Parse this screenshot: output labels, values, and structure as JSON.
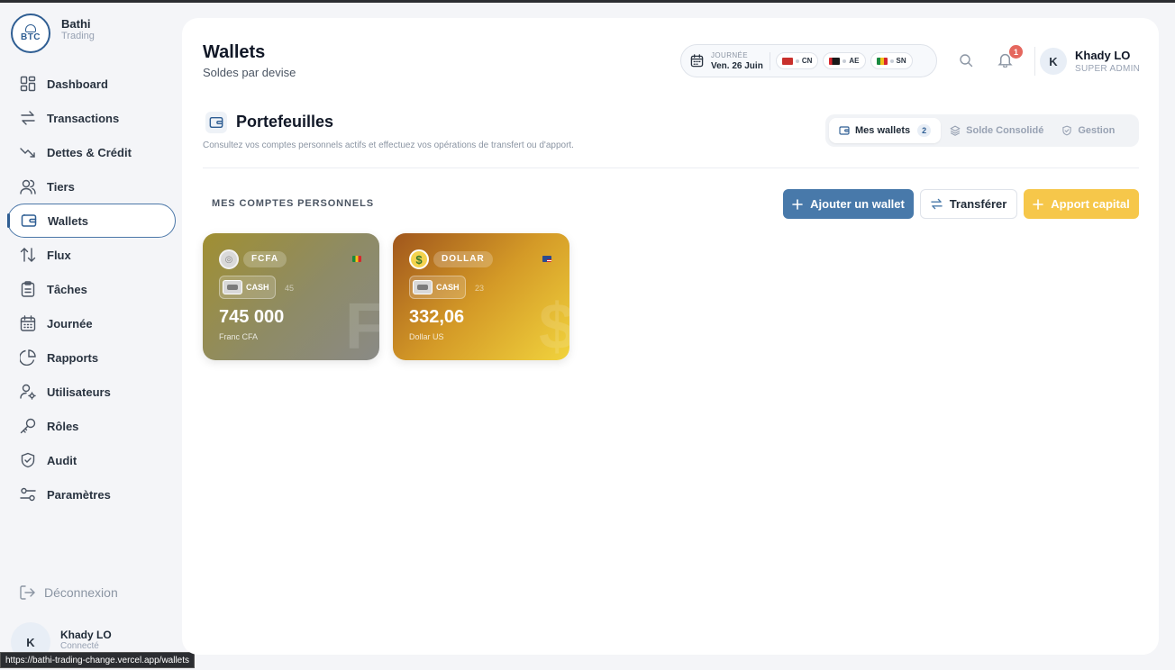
{
  "brand": {
    "name": "Bathi",
    "subtitle": "Trading",
    "logo_text": "BTC"
  },
  "sidebar": {
    "items": [
      {
        "label": "Dashboard",
        "icon": "grid-icon"
      },
      {
        "label": "Transactions",
        "icon": "arrows-left-right-icon"
      },
      {
        "label": "Dettes & Crédit",
        "icon": "trend-down-icon"
      },
      {
        "label": "Tiers",
        "icon": "users-icon"
      },
      {
        "label": "Wallets",
        "icon": "wallet-icon",
        "active": true
      },
      {
        "label": "Flux",
        "icon": "arrows-up-down-icon"
      },
      {
        "label": "Tâches",
        "icon": "clipboard-icon"
      },
      {
        "label": "Journée",
        "icon": "calendar-icon"
      },
      {
        "label": "Rapports",
        "icon": "pie-chart-icon"
      },
      {
        "label": "Utilisateurs",
        "icon": "user-gear-icon"
      },
      {
        "label": "Rôles",
        "icon": "key-icon"
      },
      {
        "label": "Audit",
        "icon": "shield-check-icon"
      },
      {
        "label": "Paramètres",
        "icon": "sliders-icon"
      }
    ],
    "logout_label": "Déconnexion",
    "user": {
      "initial": "K",
      "name": "Khady LO",
      "status": "Connecté"
    }
  },
  "status_url": "https://bathi-trading-change.vercel.app/wallets",
  "header": {
    "title": "Wallets",
    "subtitle": "Soldes par devise",
    "day": {
      "label": "JOURNÉE",
      "date": "Ven. 26 Juin"
    },
    "countries": [
      {
        "code": "CN",
        "flag_color": "#d6272d"
      },
      {
        "code": "AE",
        "flag_color": "#1a8a3e"
      },
      {
        "code": "SN",
        "flag_color": "#f2c01b"
      }
    ],
    "notification_count": "1",
    "user": {
      "initial": "K",
      "name": "Khady LO",
      "role": "SUPER ADMIN"
    }
  },
  "section": {
    "title": "Portefeuilles",
    "description": "Consultez vos comptes personnels actifs et effectuez vos opérations de transfert ou d'apport.",
    "tabs": [
      {
        "label": "Mes wallets",
        "count": "2",
        "active": true
      },
      {
        "label": "Solde Consolidé"
      },
      {
        "label": "Gestion"
      }
    ]
  },
  "wallets_list": {
    "title": "MES COMPTES PERSONNELS",
    "buttons": {
      "add": "Ajouter un wallet",
      "transfer": "Transférer",
      "capital": "Apport capital"
    },
    "cards": [
      {
        "currency": "FCFA",
        "type": "CASH",
        "count": "45",
        "amount": "745 000",
        "name": "Franc CFA",
        "watermark": "F",
        "coin": "◎"
      },
      {
        "currency": "DOLLAR",
        "type": "CASH",
        "count": "23",
        "amount": "332,06",
        "name": "Dollar US",
        "watermark": "$",
        "coin": "$"
      }
    ]
  },
  "colors": {
    "accent": "#4879aa",
    "capital": "#f6c74a",
    "badge": "#e5675e"
  }
}
